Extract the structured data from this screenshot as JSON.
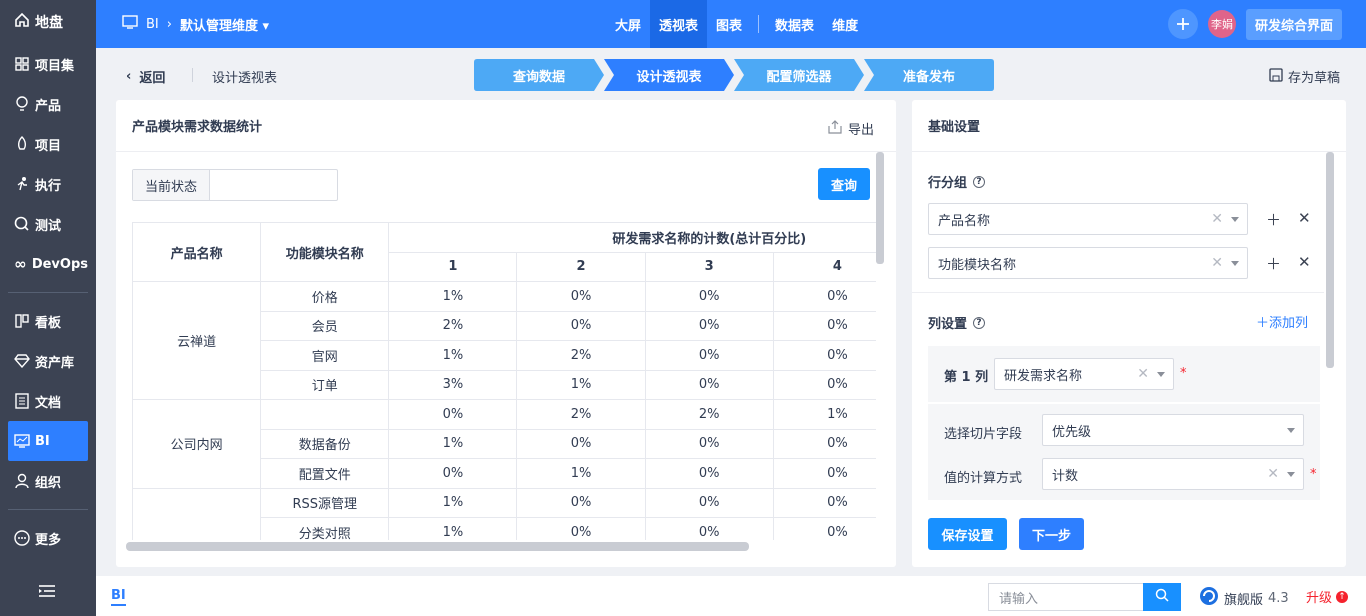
{
  "sidebar": {
    "logo": "地盘",
    "items": [
      {
        "label": "项目集",
        "icon": "grid-icon"
      },
      {
        "label": "产品",
        "icon": "bulb-icon"
      },
      {
        "label": "项目",
        "icon": "rocket-icon"
      },
      {
        "label": "执行",
        "icon": "run-icon"
      },
      {
        "label": "测试",
        "icon": "search-icon"
      },
      {
        "label": "DevOps",
        "icon": "infinity-icon"
      }
    ],
    "items2": [
      {
        "label": "看板",
        "icon": "kanban-icon"
      },
      {
        "label": "资产库",
        "icon": "diamond-icon"
      },
      {
        "label": "文档",
        "icon": "doc-icon"
      },
      {
        "label": "BI",
        "icon": "monitor-icon"
      },
      {
        "label": "组织",
        "icon": "user-icon"
      }
    ],
    "more": "更多"
  },
  "topbar": {
    "app": "BI",
    "dimension": "默认管理维度",
    "tabs": [
      "大屏",
      "透视表",
      "图表"
    ],
    "tabs2": [
      "数据表",
      "维度"
    ],
    "avatar": "李娟",
    "dev_button": "研发综合界面"
  },
  "subbar": {
    "back": "返回",
    "title": "设计透视表",
    "steps": [
      "查询数据",
      "设计透视表",
      "配置筛选器",
      "准备发布"
    ],
    "draft": "存为草稿"
  },
  "pivot": {
    "title": "产品模块需求数据统计",
    "export": "导出",
    "filter_label": "当前状态",
    "query": "查询",
    "col_product": "产品名称",
    "col_module": "功能模块名称",
    "col_group": "研发需求名称的计数(总计百分比)",
    "col_nums": [
      "1",
      "2",
      "3",
      "4"
    ],
    "groups": [
      {
        "product": "云禅道",
        "rows": [
          {
            "module": "价格",
            "v": [
              "1%",
              "0%",
              "0%",
              "0%"
            ]
          },
          {
            "module": "会员",
            "v": [
              "2%",
              "0%",
              "0%",
              "0%"
            ]
          },
          {
            "module": "官网",
            "v": [
              "1%",
              "2%",
              "0%",
              "0%"
            ]
          },
          {
            "module": "订单",
            "v": [
              "3%",
              "1%",
              "0%",
              "0%"
            ]
          }
        ]
      },
      {
        "product": "公司内网",
        "rows": [
          {
            "module": "",
            "v": [
              "0%",
              "2%",
              "2%",
              "1%"
            ]
          },
          {
            "module": "数据备份",
            "v": [
              "1%",
              "0%",
              "0%",
              "0%"
            ]
          },
          {
            "module": "配置文件",
            "v": [
              "0%",
              "1%",
              "0%",
              "0%"
            ]
          }
        ]
      },
      {
        "product": "",
        "rows": [
          {
            "module": "RSS源管理",
            "v": [
              "1%",
              "0%",
              "0%",
              "0%"
            ]
          },
          {
            "module": "分类对照",
            "v": [
              "1%",
              "0%",
              "0%",
              "0%"
            ]
          }
        ]
      }
    ]
  },
  "settings": {
    "title": "基础设置",
    "row_group": "行分组",
    "row_fields": [
      "产品名称",
      "功能模块名称"
    ],
    "col_settings": "列设置",
    "add_col": "添加列",
    "col1_label": "第 1 列",
    "col1_value": "研发需求名称",
    "slice_label": "选择切片字段",
    "slice_value": "优先级",
    "calc_label": "值的计算方式",
    "calc_value": "计数",
    "save": "保存设置",
    "next": "下一步"
  },
  "footer": {
    "tab": "BI",
    "search_placeholder": "请输入",
    "edition": "旗舰版",
    "version": "4.3",
    "upgrade": "升级"
  },
  "colors": {
    "primary": "#2e7fff",
    "sidebar": "#3c4353",
    "step_active": "#2e7fff",
    "step": "#4da9f5"
  }
}
